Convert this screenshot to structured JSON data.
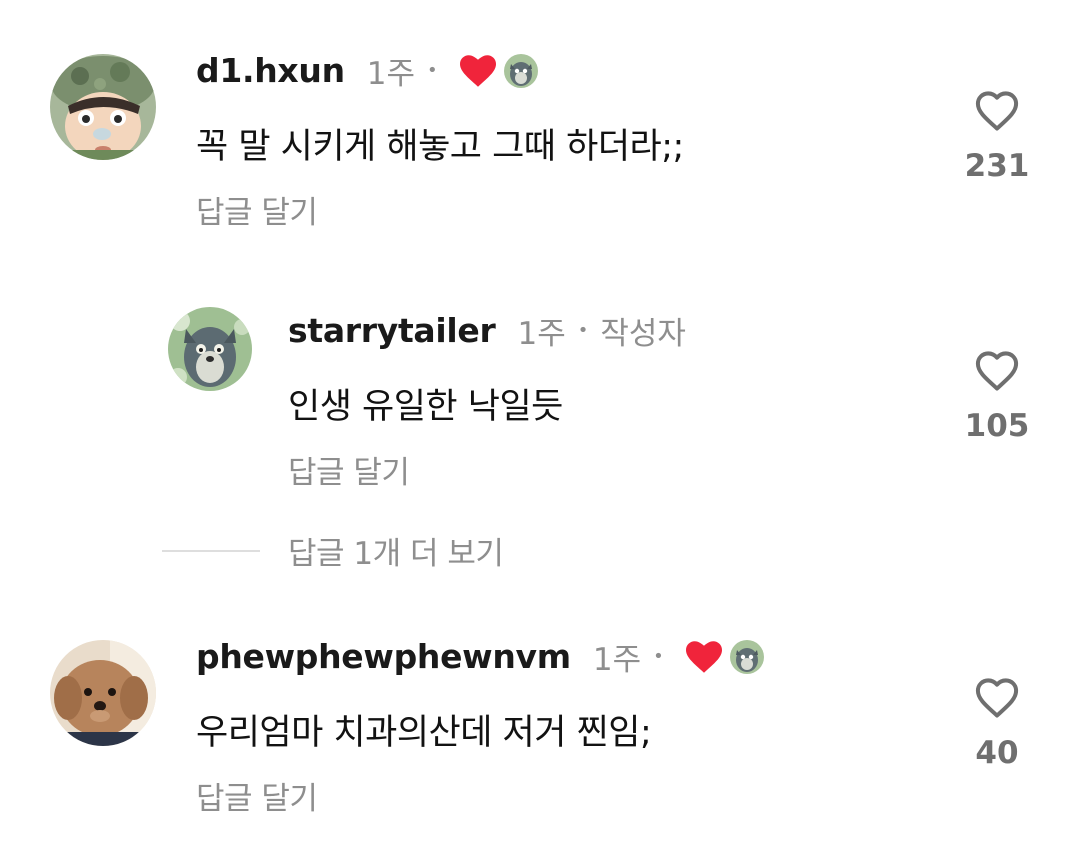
{
  "comments": [
    {
      "username": "d1.hxun",
      "time": "1주",
      "text": "꼭 말 시키게 해놓고 그때 하더라;;",
      "reply_label": "답글 달기",
      "likes": "231",
      "creator_liked": true
    },
    {
      "username": "starrytailer",
      "time": "1주",
      "author_tag": "작성자",
      "text": "인생 유일한 낙일듯",
      "reply_label": "답글 달기",
      "likes": "105"
    },
    {
      "username": "phewphewphewnvm",
      "time": "1주",
      "text": "우리엄마 치과의산데 저거 찐임;",
      "reply_label": "답글 달기",
      "likes": "40",
      "creator_liked": true
    }
  ],
  "more_replies_label": "답글 1개 더 보기",
  "separator": "•",
  "icons": {
    "like": "heart-outline-icon",
    "creator_like": "heart-filled-icon"
  },
  "colors": {
    "creator_heart": "#f0243b",
    "secondary_text": "#8e8e8e",
    "like_count": "#6f6f6f"
  }
}
